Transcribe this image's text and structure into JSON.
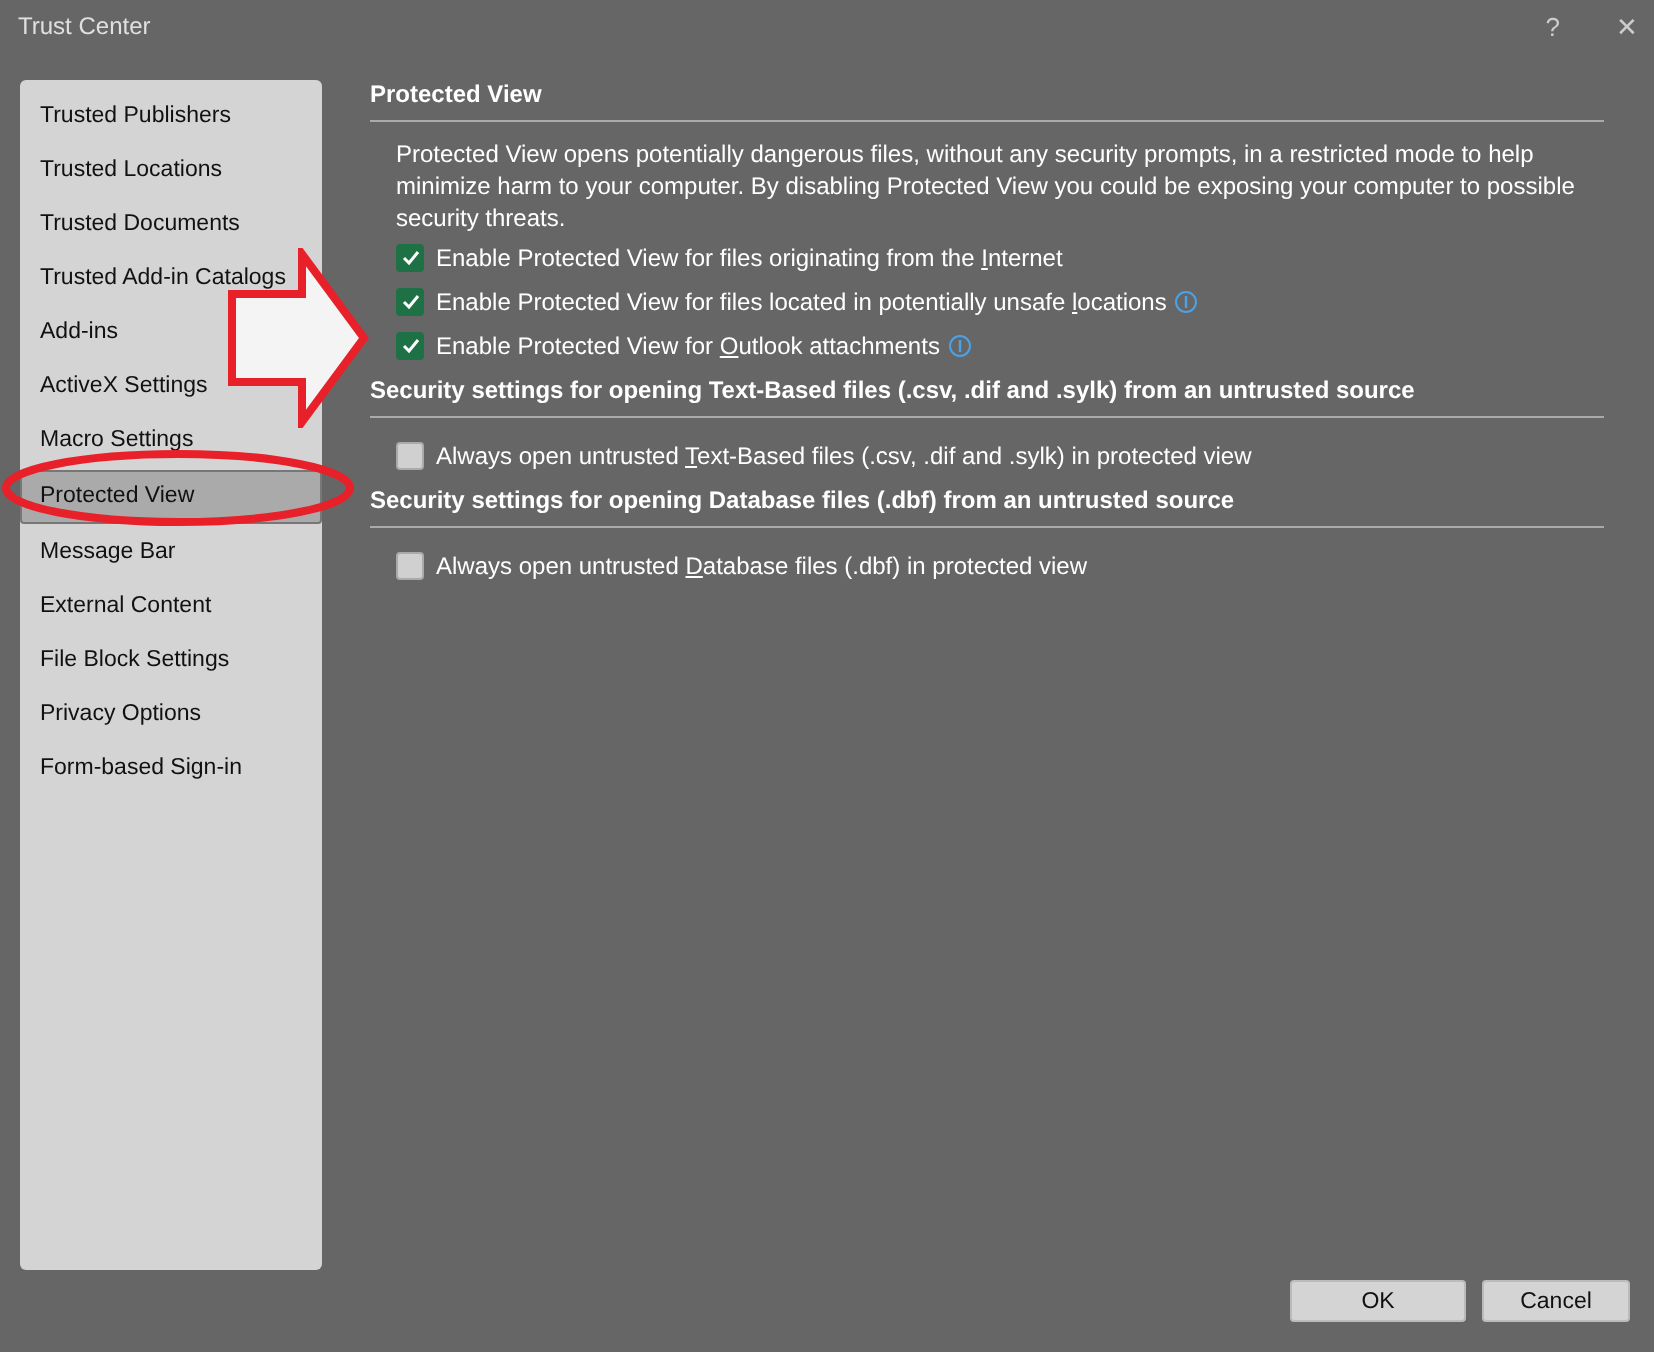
{
  "window": {
    "title": "Trust Center",
    "help": "?",
    "close": "✕"
  },
  "sidebar": {
    "items": [
      {
        "label": "Trusted Publishers",
        "selected": false
      },
      {
        "label": "Trusted Locations",
        "selected": false
      },
      {
        "label": "Trusted Documents",
        "selected": false
      },
      {
        "label": "Trusted Add-in Catalogs",
        "selected": false
      },
      {
        "label": "Add-ins",
        "selected": false
      },
      {
        "label": "ActiveX Settings",
        "selected": false
      },
      {
        "label": "Macro Settings",
        "selected": false
      },
      {
        "label": "Protected View",
        "selected": true
      },
      {
        "label": "Message Bar",
        "selected": false
      },
      {
        "label": "External Content",
        "selected": false
      },
      {
        "label": "File Block Settings",
        "selected": false
      },
      {
        "label": "Privacy Options",
        "selected": false
      },
      {
        "label": "Form-based Sign-in",
        "selected": false
      }
    ]
  },
  "sections": [
    {
      "heading": "Protected View",
      "description": "Protected View opens potentially dangerous files, without any security prompts, in a restricted mode to help minimize harm to your computer. By disabling Protected View you could be exposing your computer to possible security threats.",
      "options": [
        {
          "before": "Enable Protected View for files originating from the ",
          "key": "I",
          "after": "nternet",
          "checked": true,
          "info": false
        },
        {
          "before": "Enable Protected View for files located in potentially unsafe ",
          "key": "l",
          "after": "ocations",
          "checked": true,
          "info": true
        },
        {
          "before": "Enable Protected View for ",
          "key": "O",
          "after": "utlook attachments",
          "checked": true,
          "info": true
        }
      ]
    },
    {
      "heading": "Security settings for opening Text-Based files (.csv, .dif and .sylk) from an untrusted source",
      "options": [
        {
          "before": "Always open untrusted ",
          "key": "T",
          "after": "ext-Based files (.csv, .dif and .sylk) in protected view",
          "checked": false,
          "info": false
        }
      ]
    },
    {
      "heading": "Security settings for opening Database files (.dbf) from an untrusted source",
      "options": [
        {
          "before": "Always open untrusted ",
          "key": "D",
          "after": "atabase files (.dbf) in protected view",
          "checked": false,
          "info": false
        }
      ]
    }
  ],
  "buttons": [
    "OK",
    "Cancel"
  ]
}
